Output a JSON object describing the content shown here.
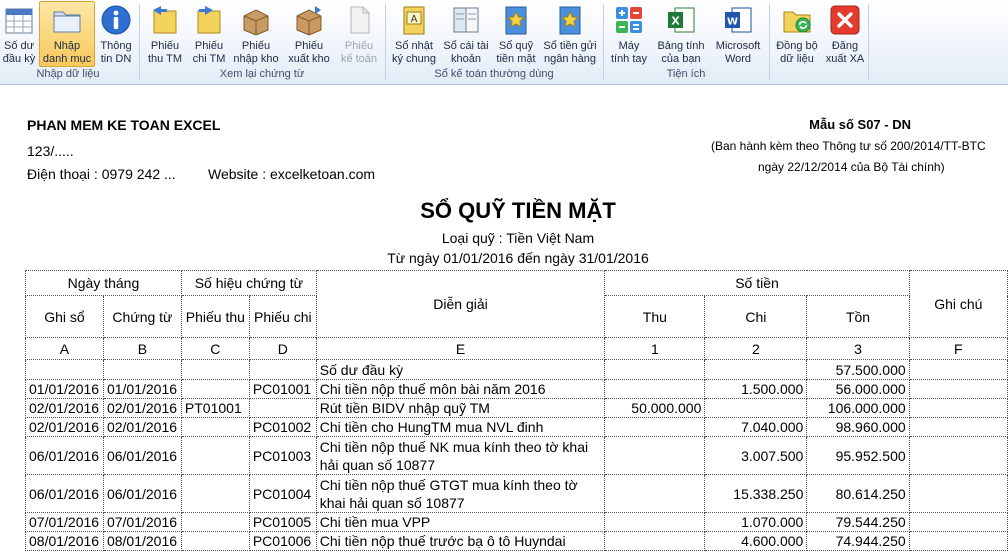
{
  "ribbon": {
    "groups": [
      {
        "label": "Nhập dữ liệu",
        "buttons": [
          {
            "label": "Số dư\nđầu kỳ",
            "icon": "calendar-icon"
          },
          {
            "label": "Nhập\ndanh mục",
            "icon": "folder-icon",
            "active": true
          },
          {
            "label": "Thông\ntin DN",
            "icon": "info-icon"
          }
        ]
      },
      {
        "label": "Xem lại chứng từ",
        "buttons": [
          {
            "label": "Phiếu\nthu TM",
            "icon": "receipt-in-icon"
          },
          {
            "label": "Phiếu\nchi TM",
            "icon": "receipt-out-icon"
          },
          {
            "label": "Phiếu\nnhập kho",
            "icon": "box-in-icon"
          },
          {
            "label": "Phiếu\nxuất kho",
            "icon": "box-out-icon"
          },
          {
            "label": "Phiếu\nkế toán",
            "icon": "document-icon",
            "disabled": true
          }
        ]
      },
      {
        "label": "Sổ kế toán thường dùng",
        "buttons": [
          {
            "label": "Sổ nhật\nký chung",
            "icon": "journal-book-icon"
          },
          {
            "label": "Sổ cái tài\nkhoản",
            "icon": "ledger-icon"
          },
          {
            "label": "Sổ quỹ\ntiền mặt",
            "icon": "cash-book-icon"
          },
          {
            "label": "Sổ tiền gửi\nngân hàng",
            "icon": "bank-book-icon"
          }
        ]
      },
      {
        "label": "Tiện ích",
        "buttons": [
          {
            "label": "Máy\ntính tay",
            "icon": "calculator-icon"
          },
          {
            "label": "Bảng tính\ncủa bạn",
            "icon": "excel-icon"
          },
          {
            "label": "Microsoft\nWord",
            "icon": "word-icon"
          }
        ]
      },
      {
        "label": "",
        "buttons": [
          {
            "label": "Đồng bộ\ndữ liệu",
            "icon": "sync-icon"
          },
          {
            "label": "Đăng\nxuất XA",
            "icon": "logout-icon"
          }
        ]
      }
    ]
  },
  "report": {
    "company_name": "PHAN MEM KE TOAN EXCEL",
    "address": "123/.....",
    "phone": "Điện thoại :  0979 242 ...",
    "website": "Website : excelketoan.com",
    "form_no": "Mẫu số S07 - DN",
    "decree_line1": "(Ban hành kèm theo Thông tư số 200/2014/TT-BTC",
    "decree_line2": "ngày 22/12/2014 của Bộ Tài chính)",
    "title": "SỔ QUỸ TIỀN MẶT",
    "fund_type": "Loại quỹ : Tiền Việt Nam",
    "period": "Từ ngày 01/01/2016 đến ngày 31/01/2016"
  },
  "table": {
    "h_date": "Ngày tháng",
    "h_voucher_no": "Số hiệu chứng từ",
    "h_desc": "Diễn giải",
    "h_amount": "Số tiền",
    "h_note": "Ghi chú",
    "h_post": "Ghi sổ",
    "h_doc": "Chứng từ",
    "h_receipt": "Phiếu thu",
    "h_payment": "Phiếu chi",
    "h_in": "Thu",
    "h_out": "Chi",
    "h_bal": "Tồn",
    "codes": [
      "A",
      "B",
      "C",
      "D",
      "E",
      "1",
      "2",
      "3",
      "F"
    ],
    "opening": {
      "desc": "Số dư đầu kỳ",
      "balance": "57.500.000"
    },
    "rows": [
      {
        "post": "01/01/2016",
        "doc": "01/01/2016",
        "receipt": "",
        "payment": "PC01001",
        "desc": "Chi tiền nộp thuế môn bài năm 2016",
        "in": "",
        "out": "1.500.000",
        "bal": "56.000.000"
      },
      {
        "post": "02/01/2016",
        "doc": "02/01/2016",
        "receipt": "PT01001",
        "payment": "",
        "desc": "Rút tiền BIDV nhập quỹ TM",
        "in": "50.000.000",
        "out": "",
        "bal": "106.000.000"
      },
      {
        "post": "02/01/2016",
        "doc": "02/01/2016",
        "receipt": "",
        "payment": "PC01002",
        "desc": "Chi tiền cho HungTM mua NVL đinh",
        "in": "",
        "out": "7.040.000",
        "bal": "98.960.000"
      },
      {
        "post": "06/01/2016",
        "doc": "06/01/2016",
        "receipt": "",
        "payment": "PC01003",
        "desc": "Chi tiền nộp thuế NK mua kính theo tờ khai hải quan số 10877",
        "in": "",
        "out": "3.007.500",
        "bal": "95.952.500",
        "tall": true
      },
      {
        "post": "06/01/2016",
        "doc": "06/01/2016",
        "receipt": "",
        "payment": "PC01004",
        "desc": "Chi tiền nộp thuế GTGT mua kính theo tờ khai hải quan số 10877",
        "in": "",
        "out": "15.338.250",
        "bal": "80.614.250",
        "tall": true
      },
      {
        "post": "07/01/2016",
        "doc": "07/01/2016",
        "receipt": "",
        "payment": "PC01005",
        "desc": "Chi tiền mua VPP",
        "in": "",
        "out": "1.070.000",
        "bal": "79.544.250"
      },
      {
        "post": "08/01/2016",
        "doc": "08/01/2016",
        "receipt": "",
        "payment": "PC01006",
        "desc": "Chi tiền nộp thuế trước bạ ô tô Huyndai",
        "in": "",
        "out": "4.600.000",
        "bal": "74.944.250"
      }
    ]
  }
}
